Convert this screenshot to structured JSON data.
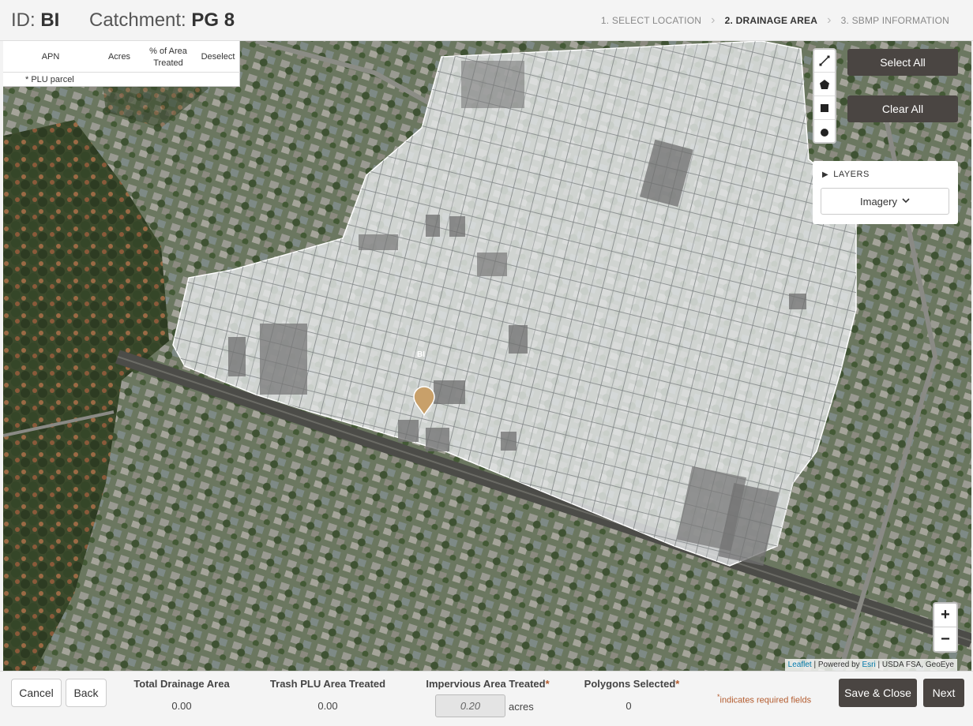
{
  "header": {
    "id_label": "ID:",
    "id_value": "BI",
    "catchment_label": "Catchment:",
    "catchment_value": "PG 8",
    "steps": [
      {
        "label": "1. SELECT LOCATION"
      },
      {
        "label": "2. DRAINAGE AREA"
      },
      {
        "label": "3. SBMP INFORMATION"
      }
    ]
  },
  "apn_table": {
    "columns": [
      "APN",
      "Acres",
      "% of Area Treated",
      "Deselect"
    ],
    "note": "* PLU parcel"
  },
  "map": {
    "select_all_label": "Select All",
    "clear_all_label": "Clear All",
    "draw_tools": [
      "polyline-icon",
      "polygon-icon",
      "rectangle-icon",
      "circle-icon"
    ],
    "layers_title": "LAYERS",
    "layers_selected": "Imagery",
    "zoom_in": "+",
    "zoom_out": "−",
    "marker_label": "BI",
    "attribution": {
      "leaflet": "Leaflet",
      "powered_by": " | Powered by ",
      "esri": "Esri",
      "sources": " | USDA FSA, GeoEye"
    },
    "colors": {
      "selected_overlay": "#e6e9ea",
      "marker": "#c8a06a"
    }
  },
  "footer": {
    "cancel_label": "Cancel",
    "back_label": "Back",
    "total_drainage_label": "Total Drainage Area",
    "total_drainage_value": "0.00",
    "trash_plu_label": "Trash PLU Area Treated",
    "trash_plu_value": "0.00",
    "impervious_label": "Impervious Area Treated",
    "impervious_value": "0.20",
    "impervious_unit": "acres",
    "polygons_label": "Polygons Selected",
    "polygons_value": "0",
    "required_star": "*",
    "required_note": "indicates required fields",
    "save_close_label": "Save & Close",
    "next_label": "Next"
  }
}
